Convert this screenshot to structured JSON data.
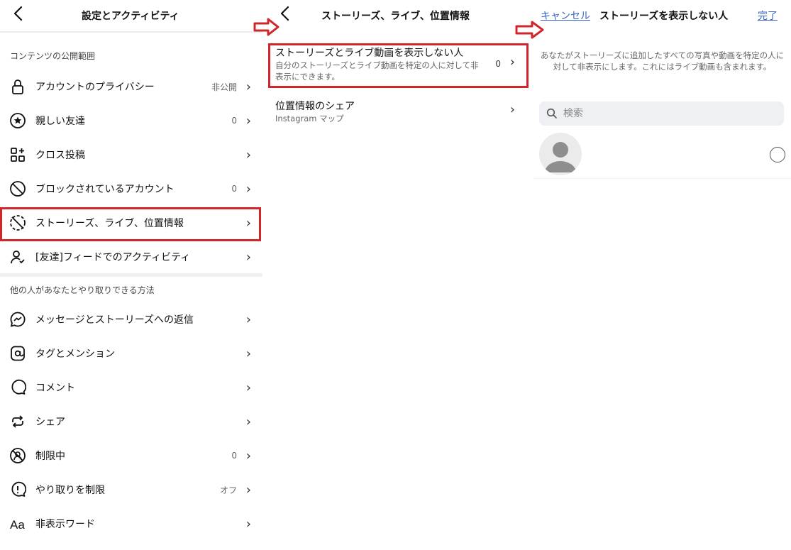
{
  "settings": {
    "title": "設定とアクティビティ",
    "section1": "コンテンツの公開範囲",
    "items1": [
      {
        "label": "アカウントのプライバシー",
        "value": "非公開",
        "icon": "lock-icon"
      },
      {
        "label": "親しい友達",
        "value": "0",
        "icon": "star-circle-icon"
      },
      {
        "label": "クロス投稿",
        "value": "",
        "icon": "grid-plus-icon"
      },
      {
        "label": "ブロックされているアカウント",
        "value": "0",
        "icon": "block-icon"
      },
      {
        "label": "ストーリーズ、ライブ、位置情報",
        "value": "",
        "icon": "story-off-icon"
      },
      {
        "label": "[友達]フィードでのアクティビティ",
        "value": "",
        "icon": "person-check-icon"
      }
    ],
    "section2": "他の人があなたとやり取りできる方法",
    "items2": [
      {
        "label": "メッセージとストーリーズへの返信",
        "value": "",
        "icon": "messenger-icon"
      },
      {
        "label": "タグとメンション",
        "value": "",
        "icon": "at-icon"
      },
      {
        "label": "コメント",
        "value": "",
        "icon": "comment-icon"
      },
      {
        "label": "シェア",
        "value": "",
        "icon": "share-icon"
      },
      {
        "label": "制限中",
        "value": "0",
        "icon": "restrict-icon"
      },
      {
        "label": "やり取りを制限",
        "value": "オフ",
        "icon": "limit-icon"
      },
      {
        "label": "非表示ワード",
        "value": "",
        "icon": "text-aa-icon"
      }
    ]
  },
  "stories": {
    "title": "ストーリーズ、ライブ、位置情報",
    "hide_title": "ストーリーズとライブ動画を表示しない人",
    "hide_desc": "自分のストーリーズとライブ動画を特定の人に対して非表示にできます。",
    "hide_count": "0",
    "location_title": "位置情報のシェア",
    "location_desc": "Instagram マップ"
  },
  "hide_from": {
    "cancel": "キャンセル",
    "title": "ストーリーズを表示しない人",
    "done": "完了",
    "description": "あなたがストーリーズに追加したすべての写真や動画を特定の人に対して非表示にします。これにはライブ動画も含まれます。",
    "search_placeholder": "検索"
  },
  "colors": {
    "highlight": "#d0262b",
    "link": "#3a64c6"
  }
}
